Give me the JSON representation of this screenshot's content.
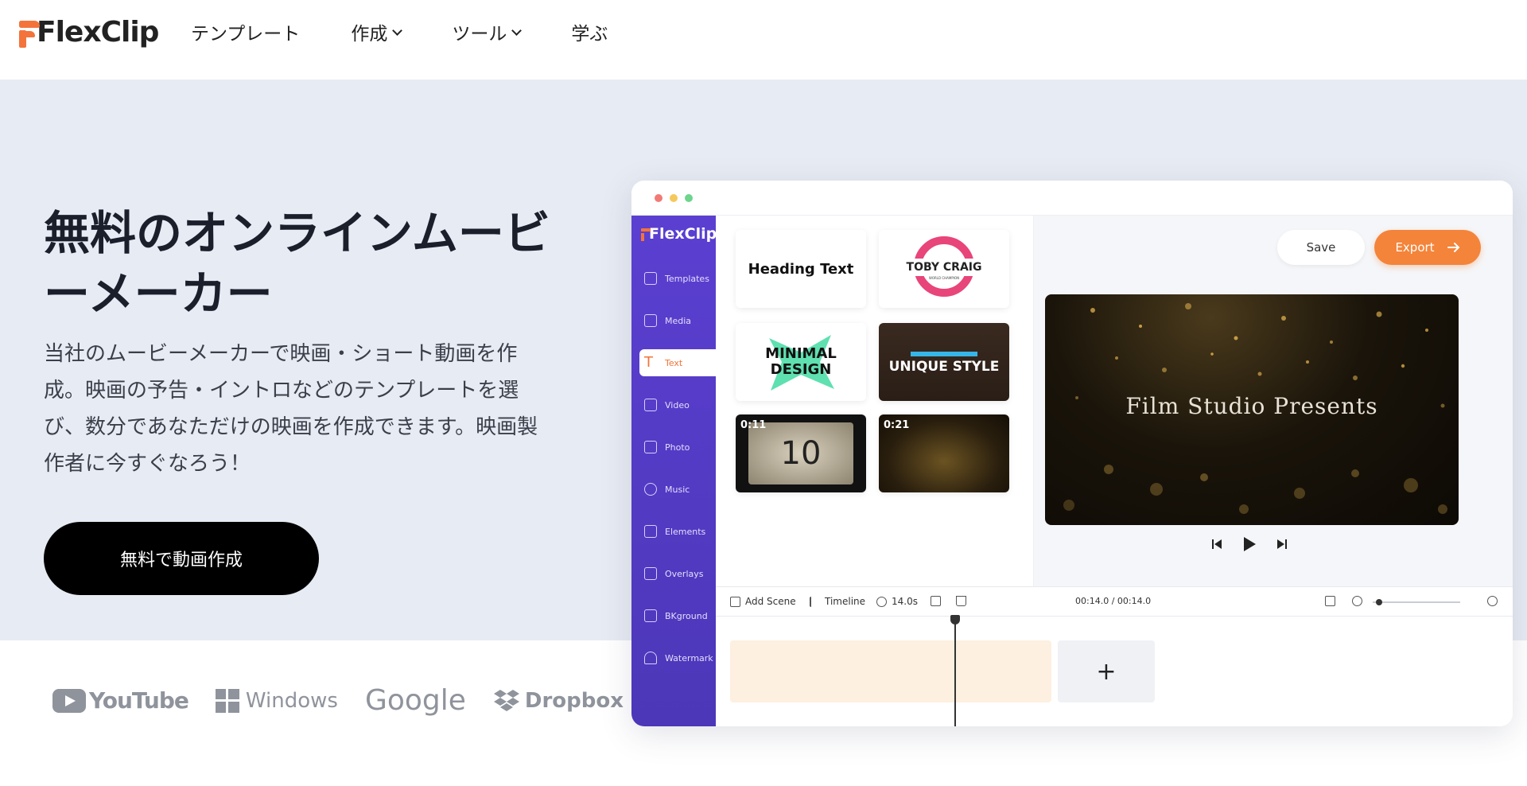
{
  "nav": {
    "logo": "FlexClip",
    "items": [
      {
        "label": "テンプレート",
        "dropdown": false
      },
      {
        "label": "作成",
        "dropdown": true
      },
      {
        "label": "ツール",
        "dropdown": true
      },
      {
        "label": "学ぶ",
        "dropdown": false
      }
    ]
  },
  "hero": {
    "title_line1": "無料のオンラインムービ",
    "title_line2": "ーメーカー",
    "desc_line1": "当社のムービーメーカーで映画・ショート動画を作",
    "desc_line2": "成。映画の予告・イントロなどのテンプレートを選",
    "desc_line3": "び、数分であなただけの映画を作成できます。映画製",
    "desc_line4": "作者に今すぐなろう！",
    "cta": "無料で動画作成"
  },
  "brands": {
    "youtube": "YouTube",
    "windows": "Windows",
    "google": "Google",
    "dropbox": "Dropbox"
  },
  "app": {
    "sidebar_logo": "FlexClip",
    "sidebar": [
      {
        "label": "Templates",
        "icon": "layers-icon"
      },
      {
        "label": "Media",
        "icon": "media-icon"
      },
      {
        "label": "Text",
        "icon": "text-icon",
        "active": true
      },
      {
        "label": "Video",
        "icon": "video-icon"
      },
      {
        "label": "Photo",
        "icon": "photo-icon"
      },
      {
        "label": "Music",
        "icon": "music-icon"
      },
      {
        "label": "Elements",
        "icon": "elements-icon"
      },
      {
        "label": "Overlays",
        "icon": "overlays-icon"
      },
      {
        "label": "BKground",
        "icon": "background-icon"
      },
      {
        "label": "Watermark",
        "icon": "watermark-icon"
      }
    ],
    "cards": {
      "heading": "Heading Text",
      "toby": "TOBY CRAIG",
      "toby_sub": "WORLD CHAMPION",
      "minimal1": "MINIMAL",
      "minimal2": "DESIGN",
      "unique": "UNIQUE STYLE",
      "countdown_num": "10",
      "dur1": "0:11",
      "dur2": "0:21"
    },
    "save": "Save",
    "export": "Export",
    "video_title": "Film Studio Presents",
    "toolbar": {
      "add_scene": "Add Scene",
      "timeline": "Timeline",
      "duration": "14.0s",
      "time": "00:14.0 / 00:14.0"
    },
    "timeline_add": "+",
    "colors": {
      "accent": "#f4843a",
      "sidebar": "#5b3fd1"
    }
  }
}
